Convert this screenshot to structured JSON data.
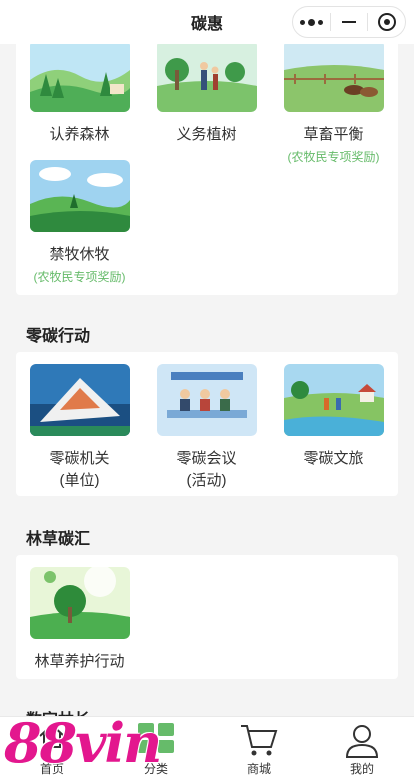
{
  "nav": {
    "title": "碳惠"
  },
  "top_section": {
    "items": [
      {
        "label": "认养森林",
        "sub": ""
      },
      {
        "label": "义务植树",
        "sub": ""
      },
      {
        "label": "草畜平衡",
        "sub": "(农牧民专项奖励)"
      },
      {
        "label": "禁牧休牧",
        "sub": "(农牧民专项奖励)"
      }
    ]
  },
  "zero_carbon": {
    "title": "零碳行动",
    "items": [
      {
        "label": "零碳机关",
        "label2": "(单位)"
      },
      {
        "label": "零碳会议",
        "label2": "(活动)"
      },
      {
        "label": "零碳文旅",
        "label2": ""
      }
    ]
  },
  "forest_sink": {
    "title": "林草碳汇",
    "items": [
      {
        "label": "林草养护行动"
      }
    ]
  },
  "digital": {
    "title": "数字林长"
  },
  "tabbar": {
    "tabs": [
      {
        "label": "首页",
        "icon": "home-icon"
      },
      {
        "label": "分类",
        "icon": "grid-icon"
      },
      {
        "label": "商城",
        "icon": "cart-icon"
      },
      {
        "label": "我的",
        "icon": "user-icon"
      }
    ]
  },
  "watermark": {
    "text": "88vin"
  },
  "colors": {
    "accent_green": "#66bb6a",
    "watermark": "#e3178e"
  }
}
